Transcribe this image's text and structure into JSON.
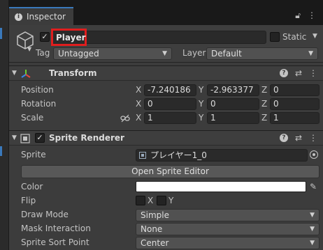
{
  "tab": {
    "title": "Inspector"
  },
  "header": {
    "name": "Player",
    "static_label": "Static",
    "tag_label": "Tag",
    "tag_value": "Untagged",
    "layer_label": "Layer",
    "layer_value": "Default"
  },
  "transform": {
    "title": "Transform",
    "position": {
      "label": "Position",
      "x": "-7.240186",
      "y": "-2.963377",
      "z": "0"
    },
    "rotation": {
      "label": "Rotation",
      "x": "0",
      "y": "0",
      "z": "0"
    },
    "scale": {
      "label": "Scale",
      "x": "1",
      "y": "1",
      "z": "1"
    }
  },
  "axes": {
    "x": "X",
    "y": "Y",
    "z": "Z"
  },
  "sprite_renderer": {
    "title": "Sprite Renderer",
    "sprite_label": "Sprite",
    "sprite_value": "プレイヤー1_0",
    "open_editor": "Open Sprite Editor",
    "color_label": "Color",
    "color_value": "#ffffff",
    "flip_label": "Flip",
    "flip_x": "X",
    "flip_y": "Y",
    "draw_mode_label": "Draw Mode",
    "draw_mode_value": "Simple",
    "mask_label": "Mask Interaction",
    "mask_value": "None",
    "sort_point_label": "Sprite Sort Point",
    "sort_point_value": "Center"
  },
  "icons": [
    "info-icon",
    "lock-icon",
    "menu-icon",
    "cube-icon",
    "transform-icon",
    "sprite-renderer-icon",
    "help-icon",
    "sliders-icon",
    "link-icon",
    "target-icon",
    "eyedropper-icon"
  ],
  "colors": {
    "accent": "#3a79bb",
    "highlight": "#e01e1e",
    "panel": "#3c3c3c"
  }
}
